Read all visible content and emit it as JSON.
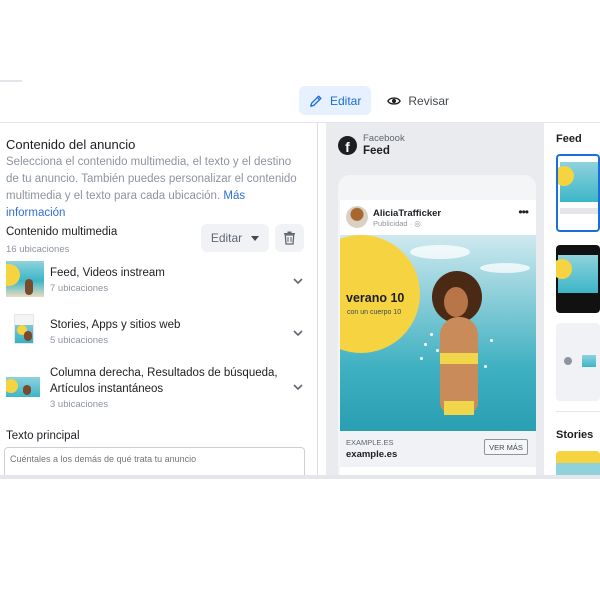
{
  "header": {
    "tabs": [
      {
        "label": "Editar",
        "icon": "pencil-icon",
        "active": true
      },
      {
        "label": "Revisar",
        "icon": "eye-icon",
        "active": false
      }
    ]
  },
  "editor": {
    "section_title": "Contenido del anuncio",
    "section_desc": "Selecciona el contenido multimedia, el texto y el destino de tu anuncio. También puedes personalizar el contenido multimedia y el texto para cada ubicación.",
    "more_info_link": "Más información",
    "media": {
      "title": "Contenido multimedia",
      "count": "16 ubicaciones",
      "edit_label": "Editar"
    },
    "placements": [
      {
        "name": "Feed, Videos instream",
        "count": "7 ubicaciones"
      },
      {
        "name": "Stories, Apps y sitios web",
        "count": "5 ubicaciones"
      },
      {
        "name": "Columna derecha, Resultados de búsqueda, Artículos instantáneos",
        "count": "3 ubicaciones"
      }
    ],
    "primary_text": {
      "title": "Texto principal",
      "placeholder": "Cuéntales a los demás de qué trata tu anuncio"
    }
  },
  "preview": {
    "platform_label": "Facebook",
    "placement_name": "Feed",
    "post": {
      "username": "AliciaTrafficker",
      "sponsored": "Publicidad · ",
      "more": "•••",
      "slogan": "verano 10",
      "subslogan": "con un cuerpo 10",
      "domain_upper": "EXAMPLE.ES",
      "domain": "example.es",
      "cta": "VER MÁS"
    }
  },
  "placements_column": {
    "feed_heading": "Feed",
    "stories_heading": "Stories"
  },
  "colors": {
    "accent_blue": "#1a6ed8",
    "active_tab_bg": "#e7f0fd",
    "sun_yellow": "#f6d341",
    "sea_teal": "#3cb6c8"
  }
}
